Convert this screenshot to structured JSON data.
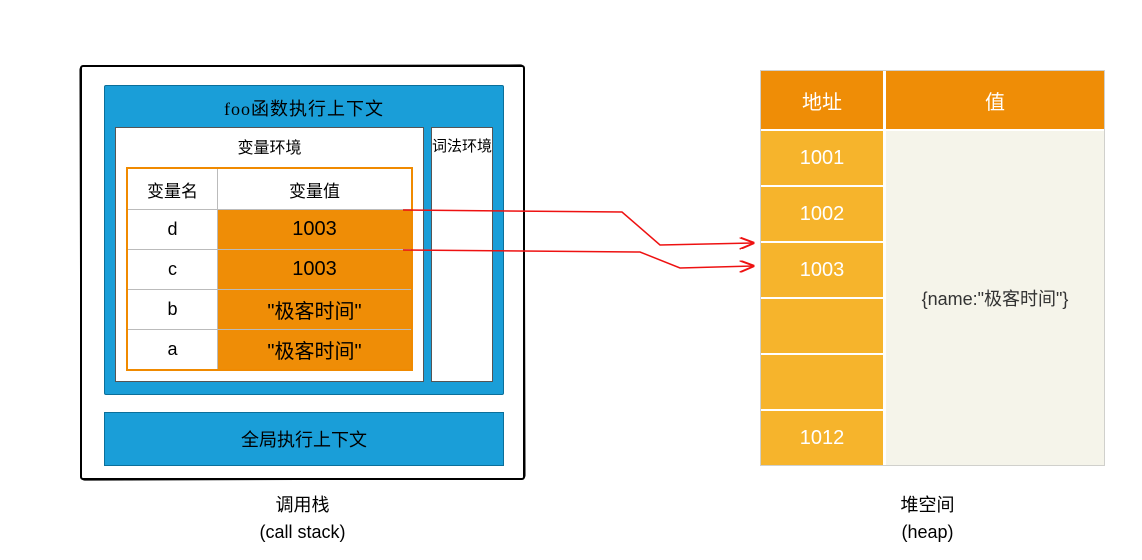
{
  "callStack": {
    "fooContext": {
      "title": "foo函数执行上下文",
      "varEnvTitle": "变量环境",
      "lexEnvTitle": "词法环境",
      "table": {
        "nameHeader": "变量名",
        "valueHeader": "变量值",
        "rows": [
          {
            "name": "d",
            "value": "1003"
          },
          {
            "name": "c",
            "value": "1003"
          },
          {
            "name": "b",
            "value": "\"极客时间\""
          },
          {
            "name": "a",
            "value": "\"极客时间\""
          }
        ]
      }
    },
    "globalContext": {
      "title": "全局执行上下文"
    },
    "caption": {
      "zh": "调用栈",
      "en": "(call stack)"
    }
  },
  "heap": {
    "headers": {
      "address": "地址",
      "value": "值"
    },
    "addresses": [
      "1001",
      "1002",
      "1003",
      "",
      "",
      "1012"
    ],
    "objectValue": "{name:\"极客时间\"}",
    "caption": {
      "zh": "堆空间",
      "en": "(heap)"
    }
  },
  "pointers": [
    {
      "fromVar": "d",
      "toAddress": "1003"
    },
    {
      "fromVar": "c",
      "toAddress": "1003"
    }
  ]
}
